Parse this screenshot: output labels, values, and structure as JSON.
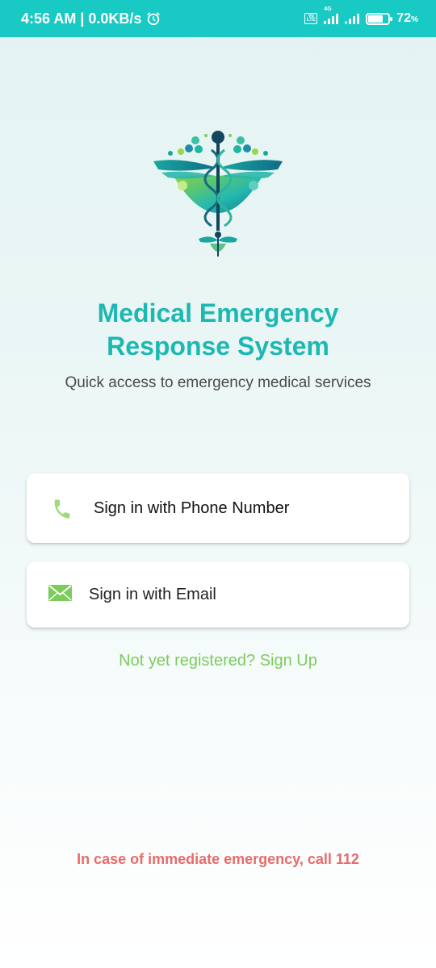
{
  "status_bar": {
    "time_text": "4:56 AM | 0.0KB/s",
    "network_label": "4G",
    "volte_label": "Vo LTE",
    "battery_percent": "72",
    "battery_unit": "%"
  },
  "app": {
    "title": "Medical Emergency Response System",
    "subtitle": "Quick access to emergency medical services"
  },
  "auth": {
    "phone_label": "Sign in with Phone Number",
    "email_label": "Sign in with Email",
    "signup_text": "Not yet registered? Sign Up"
  },
  "footer": {
    "emergency_text": "In case of immediate emergency, call 112"
  },
  "icons": {
    "phone": "phone-icon",
    "email": "envelope-icon",
    "alarm": "alarm-clock-icon",
    "logo": "caduceus-logo"
  },
  "colors": {
    "status_bar": "#19c9c3",
    "title": "#1cb8b2",
    "accent_green": "#7ccc5c",
    "emergency_red": "#e86b6b"
  }
}
